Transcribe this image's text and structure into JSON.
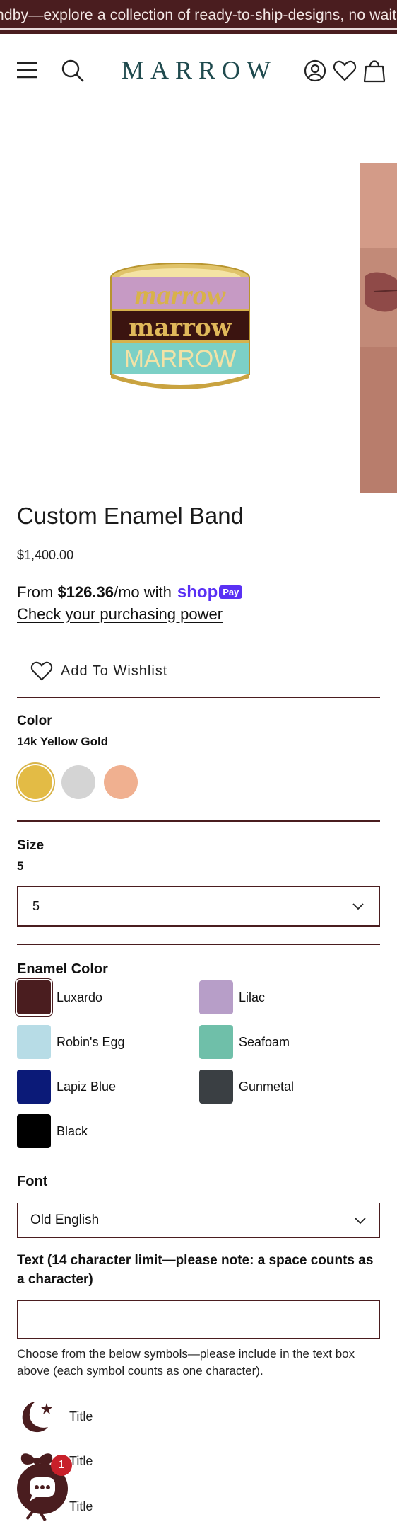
{
  "announcement": "ndby—explore a collection of ready-to-ship-designs, no waiting",
  "header": {
    "logo": "MARROW"
  },
  "product": {
    "title": "Custom Enamel Band",
    "price": "$1,400.00",
    "ring_texts": [
      "marrow",
      "marrow",
      "MARROW"
    ]
  },
  "shoppay": {
    "from": "From ",
    "amount": "$126.36",
    "suffix": "/mo with",
    "shop": "shop",
    "pay": "Pay",
    "link": "Check your purchasing power"
  },
  "wishlist_label": "Add To Wishlist",
  "color": {
    "label": "Color",
    "selected": "14k Yellow Gold",
    "swatches": [
      "#e3bb45",
      "#d4d4d4",
      "#f0b090"
    ]
  },
  "size": {
    "label": "Size",
    "selected_text": "5",
    "value": "5"
  },
  "enamel": {
    "label": "Enamel Color",
    "options": [
      {
        "name": "Luxardo",
        "color": "#4a1d1f"
      },
      {
        "name": "Lilac",
        "color": "#b79ec8"
      },
      {
        "name": "Robin's Egg",
        "color": "#b7dce6"
      },
      {
        "name": "Seafoam",
        "color": "#6fbfa9"
      },
      {
        "name": "Lapiz Blue",
        "color": "#0b1a78"
      },
      {
        "name": "Gunmetal",
        "color": "#3a3f43"
      },
      {
        "name": "Black",
        "color": "#000000"
      }
    ]
  },
  "font": {
    "label": "Font",
    "value": "Old English"
  },
  "text_field": {
    "label": "Text (14 character limit—please note: a space counts as a character)",
    "value": ""
  },
  "help_text": "Choose from the below symbols—please include in the text box above (each symbol counts as one character).",
  "symbols": [
    {
      "icon": "moon-star-icon",
      "label": "Title"
    },
    {
      "icon": "bow-icon",
      "label": "Title"
    },
    {
      "icon": "bow-icon",
      "label": "Title"
    }
  ],
  "chat": {
    "badge": "1"
  },
  "colors": {
    "accent": "#4a1d1f",
    "logo": "#1f4a4e",
    "shoppay": "#5a31f4"
  }
}
